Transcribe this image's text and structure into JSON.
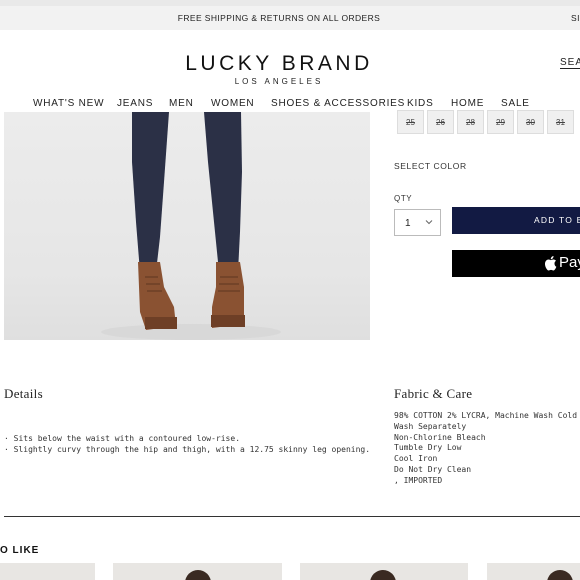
{
  "promo": {
    "message": "FREE SHIPPING & RETURNS ON ALL ORDERS",
    "sign_in_partial": "SIG"
  },
  "header": {
    "logo_title": "LUCKY BRAND",
    "logo_subtitle": "LOS ANGELES",
    "search_label": "SEA"
  },
  "nav": {
    "items": [
      "WHAT'S NEW",
      "JEANS",
      "MEN",
      "WOMEN",
      "SHOES & ACCESSORIES",
      "KIDS",
      "HOME",
      "SALE"
    ]
  },
  "product": {
    "image_icon": "jeans-boots-photo",
    "sizes": [
      "25",
      "26",
      "28",
      "29",
      "30",
      "31"
    ],
    "select_color_label": "SELECT COLOR",
    "qty_label": "QTY",
    "qty_value": "1",
    "add_to_bag_label": "ADD TO BA",
    "apple_pay_label": "Pay"
  },
  "details": {
    "title": "Details",
    "bullets": [
      "· Sits below the waist with a contoured low-rise.",
      "· Slightly curvy through the hip and thigh, with a 12.75 skinny leg opening."
    ]
  },
  "fabric": {
    "title": "Fabric & Care",
    "lines": [
      "98% COTTON 2% LYCRA, Machine Wash Cold",
      "Wash Separately",
      "Non-Chlorine Bleach",
      "Tumble Dry Low",
      "Cool Iron",
      "Do Not Dry Clean",
      ", IMPORTED"
    ]
  },
  "recommendations": {
    "title": "O LIKE"
  },
  "colors": {
    "add_to_bag_bg": "#121a43",
    "apple_pay_bg": "#000000",
    "denim": "#2b3046",
    "boot": "#8a5232"
  }
}
